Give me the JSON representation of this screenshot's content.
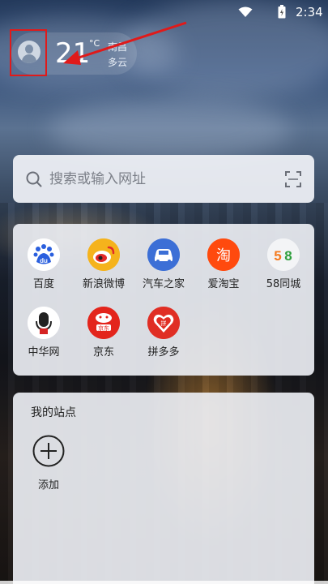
{
  "status_bar": {
    "time": "2:34",
    "wifi_icon": "wifi-icon",
    "battery_icon": "battery-icon"
  },
  "weather": {
    "temperature": "21",
    "unit": "°C",
    "city": "南昌",
    "condition": "多云",
    "avatar_icon": "user-avatar-icon"
  },
  "search": {
    "placeholder": "搜索或输入网址",
    "search_icon": "search-icon",
    "scan_icon": "scan-icon"
  },
  "quick_links": [
    {
      "label": "百度",
      "icon": "baidu-icon",
      "color": "#2a5fde"
    },
    {
      "label": "新浪微博",
      "icon": "weibo-icon",
      "color": "#f5b31c"
    },
    {
      "label": "汽车之家",
      "icon": "autohome-icon",
      "color": "#3c6fd6"
    },
    {
      "label": "爱淘宝",
      "icon": "taobao-icon",
      "color": "#ff4a0e"
    },
    {
      "label": "58同城",
      "icon": "58-icon",
      "color": "#f3f4f6"
    },
    {
      "label": "中华网",
      "icon": "china-com-icon",
      "color": "#ffffff"
    },
    {
      "label": "京东",
      "icon": "jd-icon",
      "color": "#e3251c"
    },
    {
      "label": "拼多多",
      "icon": "pinduoduo-icon",
      "color": "#e02e24"
    }
  ],
  "my_sites": {
    "title": "我的站点",
    "add_label": "添加",
    "add_icon": "plus-circle-icon"
  },
  "colors": {
    "highlight": "#e01a1a",
    "card_bg": "#eceef3"
  }
}
